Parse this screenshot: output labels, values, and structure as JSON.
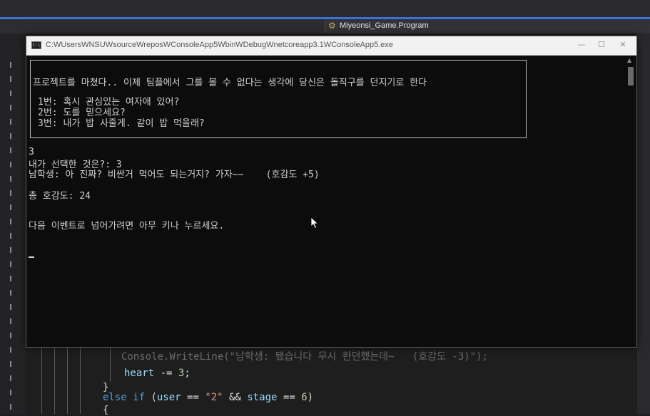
{
  "ide": {
    "nav_title": "Miyeonsi_Game.Program",
    "code_lines": [
      {
        "kind": "partial",
        "text": "Console.WriteLine(\"남학생: 됐습니다 무시 한던했는데~   (호감도 -3)\");"
      },
      {
        "kind": "stmt",
        "var": "heart",
        "op": " -= ",
        "num": "3",
        "end": ";"
      },
      {
        "kind": "brace",
        "text": "}"
      },
      {
        "kind": "cond",
        "kw": "else if",
        "open": " (",
        "var1": "user",
        "eq": " == ",
        "str": "\"2\"",
        "and": " && ",
        "var2": "stage",
        "eq2": " == ",
        "num": "6",
        "close": ")"
      },
      {
        "kind": "brace",
        "text": "{"
      }
    ]
  },
  "window": {
    "title": "C:WUsersWNSUWsourceWreposWConsoleApp5WbinWDebugWnetcoreapp3.1WConsoleApp5.exe",
    "icon_label": "C:\\",
    "controls": {
      "min": "—",
      "max": "☐",
      "close": "✕"
    }
  },
  "console": {
    "event_text": "프로젝트를 마쳤다.. 이제 팀플에서 그를 볼 수 없다는 생각에 당신은 돌직구를 던지기로 한다",
    "options": [
      "1번: 혹시 관심있는 여자애 있어?",
      "2번: 도를 믿으세요?",
      "3번: 내가 밥 사줄게. 같이 밥 먹을래?"
    ],
    "user_input": "3",
    "choice_line": "내가 선택한 것은?: 3",
    "response_line": "남학생: 아 진짜? 비싼거 먹어도 되는거지? 가자~~    (호감도 +5)",
    "total_line": "총 호감도: 24",
    "prompt_line": "다음 이벤트로 넘어가려면 아무 키나 누르세요."
  }
}
